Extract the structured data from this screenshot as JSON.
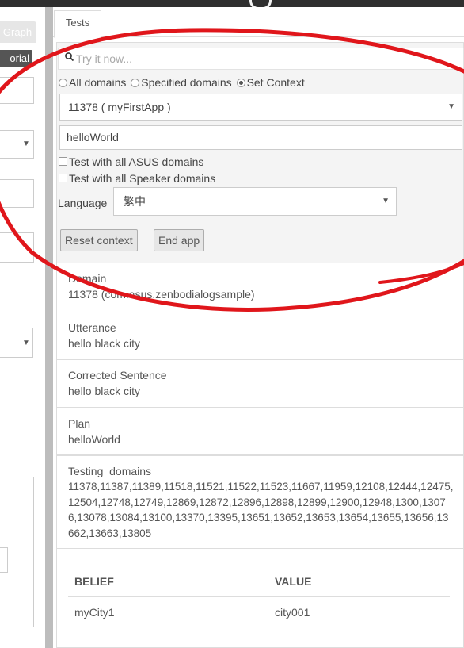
{
  "left_pane": {
    "graph_tab": "Graph",
    "tutorial_button": "orial"
  },
  "tabs": {
    "tests": "Tests"
  },
  "test_panel": {
    "search_placeholder": "Try it now...",
    "scope_options": [
      "All domains",
      "Specified domains",
      "Set Context"
    ],
    "scope_selected": "Set Context",
    "app_select": "11378 ( myFirstApp )",
    "context_value": "helloWorld",
    "check_asus": "Test with all ASUS domains",
    "check_speaker": "Test with all Speaker domains",
    "language_label": "Language",
    "language_value": "繁中",
    "reset_button": "Reset context",
    "end_button": "End app"
  },
  "results": {
    "domain_label": "Domain",
    "domain_value": "11378 (com.asus.zenbodialogsample)",
    "utterance_label": "Utterance",
    "utterance_value": "hello black city",
    "corrected_label": "Corrected Sentence",
    "corrected_value": "hello black city",
    "plan_label": "Plan",
    "plan_value": "helloWorld",
    "testing_label": "Testing_domains",
    "testing_value": "11378,11387,11389,11518,11521,11522,11523,11667,11959,12108,12444,12475,12504,12748,12749,12869,12872,12896,12898,12899,12900,12948,1300,13076,13078,13084,13100,13370,13395,13651,13652,13653,13654,13655,13656,13662,13663,13805"
  },
  "belief_table": {
    "headers": [
      "BELIEF",
      "VALUE"
    ],
    "rows": [
      [
        "myCity1",
        "city001"
      ]
    ]
  },
  "annotation": {
    "color": "#e0161b",
    "shape": "ellipse"
  }
}
